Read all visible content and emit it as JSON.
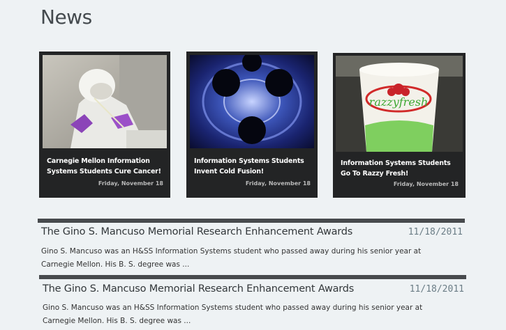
{
  "page": {
    "title": "News"
  },
  "cards": [
    {
      "title": "Carnegie Mellon Information Systems Students Cure Cancer!",
      "date": "Friday, November 18",
      "image": "lab-scientist-photo"
    },
    {
      "title": "Information Systems Students Invent Cold Fusion!",
      "date": "Friday, November 18",
      "image": "plasma-fractal-image"
    },
    {
      "title": "Information Systems Students Go To Razzy Fresh!",
      "date": "Friday, November 18",
      "image": "frozen-yogurt-cup-photo"
    }
  ],
  "articles": [
    {
      "title": "The Gino S. Mancuso Memorial Research Enhancement Awards",
      "date": "11/18/2011",
      "excerpt_line1": "Gino S. Mancuso was an H&SS Information Systems student who passed away during his senior year at",
      "excerpt_line2": "Carnegie Mellon.  His B. S. degree was ..."
    },
    {
      "title": "The Gino S. Mancuso Memorial Research Enhancement Awards",
      "date": "11/18/2011",
      "excerpt_line1": "Gino S. Mancuso was an H&SS Information Systems student who passed away during his senior year at",
      "excerpt_line2": "Carnegie Mellon.  His B. S. degree was ..."
    }
  ],
  "colors": {
    "background": "#eef2f4",
    "card": "#232425",
    "rule": "#474a4d",
    "date": "#6b7d86"
  }
}
